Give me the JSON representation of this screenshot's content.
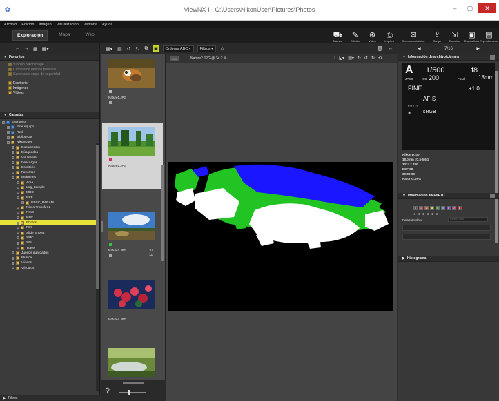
{
  "window": {
    "title": "ViewNX-i - C:\\Users\\NikonUser\\Pictures\\Photos",
    "minimize": "–",
    "maximize": "▢",
    "close": "✕"
  },
  "menu": [
    "Archivo",
    "Edición",
    "Imagen",
    "Visualización",
    "Ventana",
    "Ayuda"
  ],
  "workspace_tabs": [
    "Exploración",
    "Mapa",
    "Web"
  ],
  "main_tools": [
    {
      "label": "Transfer",
      "icon": "transfer-icon",
      "glyph": "⛟"
    },
    {
      "label": "Edición",
      "icon": "edit-icon",
      "glyph": "✎"
    },
    {
      "label": "Vídeo",
      "icon": "video-icon",
      "glyph": "⊛"
    },
    {
      "label": "Imprimir",
      "icon": "print-icon",
      "glyph": "⎙"
    },
    {
      "label": "Correo electrónico",
      "icon": "mail-icon",
      "glyph": "✉"
    },
    {
      "label": "Cargar",
      "icon": "upload-icon",
      "glyph": "⇪"
    },
    {
      "label": "Exportar",
      "icon": "export-icon",
      "glyph": "⇲"
    },
    {
      "label": "Dispositivos",
      "icon": "devices-icon",
      "glyph": "▣"
    },
    {
      "label": "Reproduc.auto.",
      "icon": "autoplay-icon",
      "glyph": "▤"
    }
  ],
  "left_toolbar": {
    "back": "←",
    "forward": "→",
    "grid": "▦",
    "grid2": "▦▾"
  },
  "favorites": {
    "header": "Favoritos",
    "dim_items": [
      "Vínculo NikonImage",
      "Carpeta de destino principal",
      "Carpeta de copia de seguridad"
    ],
    "items": [
      "Escritorio",
      "Imágenes",
      "Vídeos"
    ]
  },
  "folders": {
    "header": "Carpetas",
    "tree": [
      {
        "label": "Escritorio",
        "level": 0,
        "icon": "blue"
      },
      {
        "label": "Este equipo",
        "level": 1,
        "icon": "blue"
      },
      {
        "label": "Red",
        "level": 1,
        "icon": "blue"
      },
      {
        "label": "Bibliotecas",
        "level": 1
      },
      {
        "label": "NikonUser",
        "level": 1
      },
      {
        "label": "Documentos",
        "level": 2
      },
      {
        "label": "Búsquedas",
        "level": 2
      },
      {
        "label": "Contactos",
        "level": 2
      },
      {
        "label": "Descargas",
        "level": 2
      },
      {
        "label": "Escritorio",
        "level": 2
      },
      {
        "label": "Favoritos",
        "level": 2
      },
      {
        "label": "Imágenes",
        "level": 2
      },
      {
        "label": "Area",
        "level": 3
      },
      {
        "label": "Log_Sample",
        "level": 3
      },
      {
        "label": "MDD",
        "level": 3
      },
      {
        "label": "NEF",
        "level": 3
      },
      {
        "label": "NBSC_PARAM",
        "level": 4
      },
      {
        "label": "Nikon Transfer 2",
        "level": 3
      },
      {
        "label": "NIKE",
        "level": 3
      },
      {
        "label": "NPC",
        "level": 3
      },
      {
        "label": "Photos",
        "level": 3,
        "selected": true
      },
      {
        "label": "PDI",
        "level": 3
      },
      {
        "label": "Slide Shows",
        "level": 3
      },
      {
        "label": "SMC",
        "level": 3
      },
      {
        "label": "SPL",
        "level": 3
      },
      {
        "label": "Travel",
        "level": 3
      },
      {
        "label": "Juegos guardados",
        "level": 2
      },
      {
        "label": "Música",
        "level": 2
      },
      {
        "label": "Vídeos",
        "level": 2
      },
      {
        "label": "Vínculos",
        "level": 2
      }
    ]
  },
  "filter_panel": "Filtros",
  "center_toolbar": {
    "sort": "Ordenar ABC",
    "filter": "Filtros"
  },
  "thumbnails": [
    {
      "name": "Nature1.JPG",
      "selected": false
    },
    {
      "name": "Nature2.JPG",
      "selected": true
    },
    {
      "name": "Nature3.JPG",
      "selected": false
    },
    {
      "name": "Nature4.JPG",
      "selected": false
    },
    {
      "name": "",
      "selected": false
    }
  ],
  "viewer": {
    "filename": "Nature2.JPG @ 34.2 %",
    "tab": "Salir"
  },
  "nav": {
    "counter": "7/16",
    "prev": "◀",
    "next": "▶"
  },
  "info_panel": {
    "header": "Información de archivo/cámara",
    "mode": "A",
    "shutter": "1/500",
    "aperture": "f8",
    "iso_label": "ISO",
    "iso": "200",
    "format": "JPEG",
    "focal": "18mm",
    "focal_label": "Focal",
    "quality": "FINE",
    "exposure_comp": "+1.0",
    "af": "AF-S",
    "color_space": "sRGB",
    "meta": [
      "Nikon D100",
      "18.0mm f/3.5-5.6G",
      "3024 x 480",
      "DEF 88",
      "00:00:00",
      "Nature2.JPG"
    ]
  },
  "iptc_panel": {
    "header": "Información XMP/IPTC",
    "keywords_label": "Palabras clave",
    "keywords_hint": "Palabra clave"
  },
  "histogram_panel": {
    "header": "Histograma"
  },
  "colors": {
    "accent": "#e6e23a",
    "canvas": "#000000",
    "overlay_white": "#ffffff",
    "overlay_blue": "#1a16ff",
    "overlay_green": "#21c422"
  }
}
